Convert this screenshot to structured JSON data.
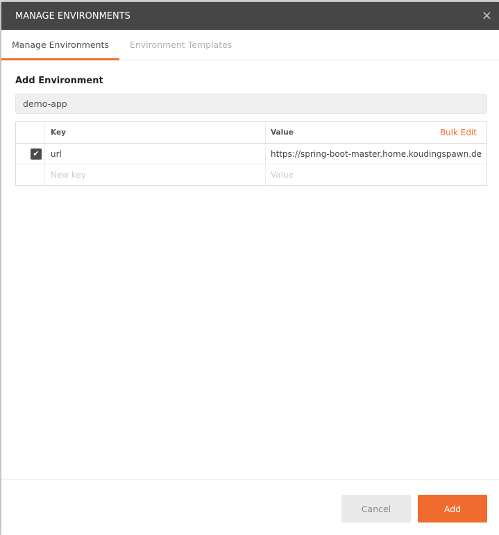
{
  "dialog": {
    "title": "MANAGE ENVIRONMENTS",
    "close_icon": "×"
  },
  "tabs": [
    {
      "label": "Manage Environments",
      "active": true
    },
    {
      "label": "Environment Templates",
      "active": false
    }
  ],
  "form": {
    "heading": "Add Environment",
    "env_name": "demo-app"
  },
  "table": {
    "key_header": "Key",
    "value_header": "Value",
    "bulk_edit": "Bulk Edit",
    "rows": [
      {
        "enabled": true,
        "key": "url",
        "value": "https://spring-boot-master.home.koudingspawn.de"
      }
    ],
    "new_key_placeholder": "New key",
    "new_value_placeholder": "Value"
  },
  "footer": {
    "cancel": "Cancel",
    "add": "Add"
  },
  "colors": {
    "accent": "#f26b2e",
    "titlebar": "#464646"
  }
}
